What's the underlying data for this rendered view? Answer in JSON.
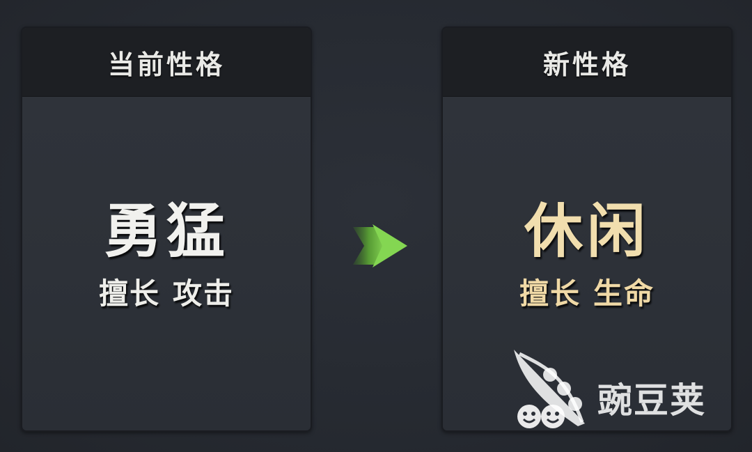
{
  "left_card": {
    "header": "当前性格",
    "trait": "勇猛",
    "skill_prefix": "擅长",
    "skill_value": "攻击"
  },
  "right_card": {
    "header": "新性格",
    "trait": "休闲",
    "skill_prefix": "擅长",
    "skill_value": "生命"
  },
  "arrow": {
    "icon": "double-chevron-right-icon",
    "color": "#7bd24a"
  },
  "watermark": {
    "text": "豌豆荚",
    "icon": "pea-pod-logo-icon"
  },
  "colors": {
    "current_text": "#f1f1ee",
    "new_text": "#f1deae",
    "header_bg": "#1d1f23",
    "card_bg": "#30343b"
  }
}
